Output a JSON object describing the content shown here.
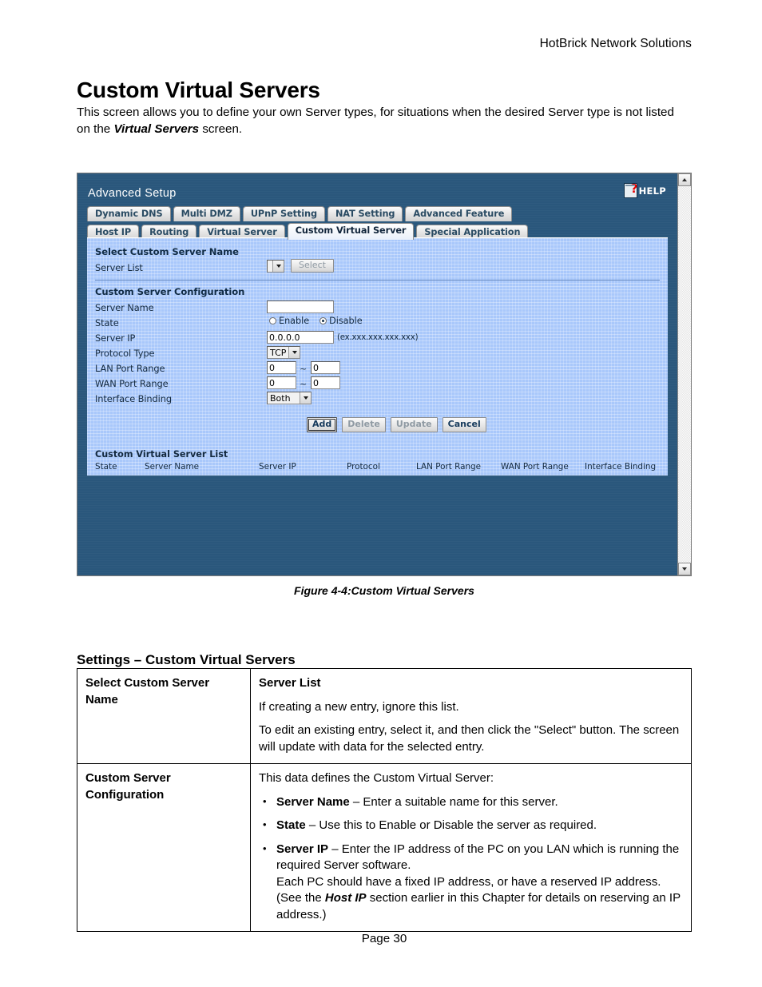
{
  "document": {
    "running_header": "HotBrick Network Solutions",
    "title": "Custom Virtual Servers",
    "intro_before": "This screen allows you to define your own Server types, for situations when the desired Server type is not listed on the ",
    "intro_bold": "Virtual Servers",
    "intro_after": " screen.",
    "figure_caption": "Figure 4-4:Custom Virtual Servers",
    "settings_heading": "Settings – Custom Virtual Servers",
    "page_footer": "Page 30"
  },
  "screenshot": {
    "app_title": "Advanced Setup",
    "help_label": "HELP",
    "help_icon": "help-question-icon",
    "tabs_row1": [
      {
        "label": "Dynamic DNS",
        "active": false
      },
      {
        "label": "Multi DMZ",
        "active": false
      },
      {
        "label": "UPnP Setting",
        "active": false
      },
      {
        "label": "NAT Setting",
        "active": false
      },
      {
        "label": "Advanced Feature",
        "active": false
      }
    ],
    "tabs_row2": [
      {
        "label": "Host IP",
        "active": false
      },
      {
        "label": "Routing",
        "active": false
      },
      {
        "label": "Virtual Server",
        "active": false
      },
      {
        "label": "Custom Virtual Server",
        "active": true
      },
      {
        "label": "Special Application",
        "active": false
      }
    ],
    "section_select": {
      "title": "Select Custom Server Name",
      "server_list_label": "Server List",
      "server_list_value": "",
      "select_button": "Select"
    },
    "section_config": {
      "title": "Custom Server Configuration",
      "server_name_label": "Server Name",
      "server_name_value": "",
      "state_label": "State",
      "state_enable": "Enable",
      "state_disable": "Disable",
      "state_selected": "Disable",
      "server_ip_label": "Server IP",
      "server_ip_value": "0.0.0.0",
      "server_ip_hint": "(ex.xxx.xxx.xxx.xxx)",
      "protocol_label": "Protocol Type",
      "protocol_value": "TCP",
      "lan_port_label": "LAN Port Range",
      "lan_port_start": "0",
      "lan_port_end": "0",
      "wan_port_label": "WAN Port Range",
      "wan_port_start": "0",
      "wan_port_end": "0",
      "range_separator": "~",
      "interface_label": "Interface Binding",
      "interface_value": "Both"
    },
    "buttons": [
      {
        "label": "Add",
        "disabled": false,
        "focused": true
      },
      {
        "label": "Delete",
        "disabled": true,
        "focused": false
      },
      {
        "label": "Update",
        "disabled": true,
        "focused": false
      },
      {
        "label": "Cancel",
        "disabled": false,
        "focused": false
      }
    ],
    "list_section": {
      "title": "Custom Virtual Server List",
      "columns": [
        "State",
        "Server Name",
        "Server IP",
        "Protocol",
        "LAN Port Range",
        "WAN Port Range",
        "Interface Binding"
      ],
      "rows": []
    },
    "colors": {
      "chrome_dark_blue": "#2a577c",
      "panel_light_blue": "#a9c8fb",
      "help_red": "#e60000",
      "button_text_blue": "#163a5c"
    }
  },
  "settings_table": {
    "rows": [
      {
        "key": "Select Custom Server Name",
        "sub_heading": "Server List",
        "paragraphs": [
          "If creating a new entry, ignore this list.",
          "To edit an existing entry, select it, and then click the \"Select\" button. The screen will update with data for the selected entry."
        ]
      },
      {
        "key": "Custom Server Configuration",
        "intro": "This data defines the Custom Virtual Server:",
        "bullets": [
          {
            "term": "Server Name",
            "text": " – Enter a suitable name for this server."
          },
          {
            "term": "State",
            "text": " – Use this to Enable or Disable the server as required."
          },
          {
            "term": "Server IP",
            "text": " – Enter the IP address of the PC on you LAN which is running the required Server software.",
            "text2_before": "Each PC should have a fixed IP address, or have a reserved IP address. (See the ",
            "text2_bold": "Host IP",
            "text2_after": " section earlier in this Chapter for details on reserving an IP address.)"
          }
        ]
      }
    ]
  }
}
